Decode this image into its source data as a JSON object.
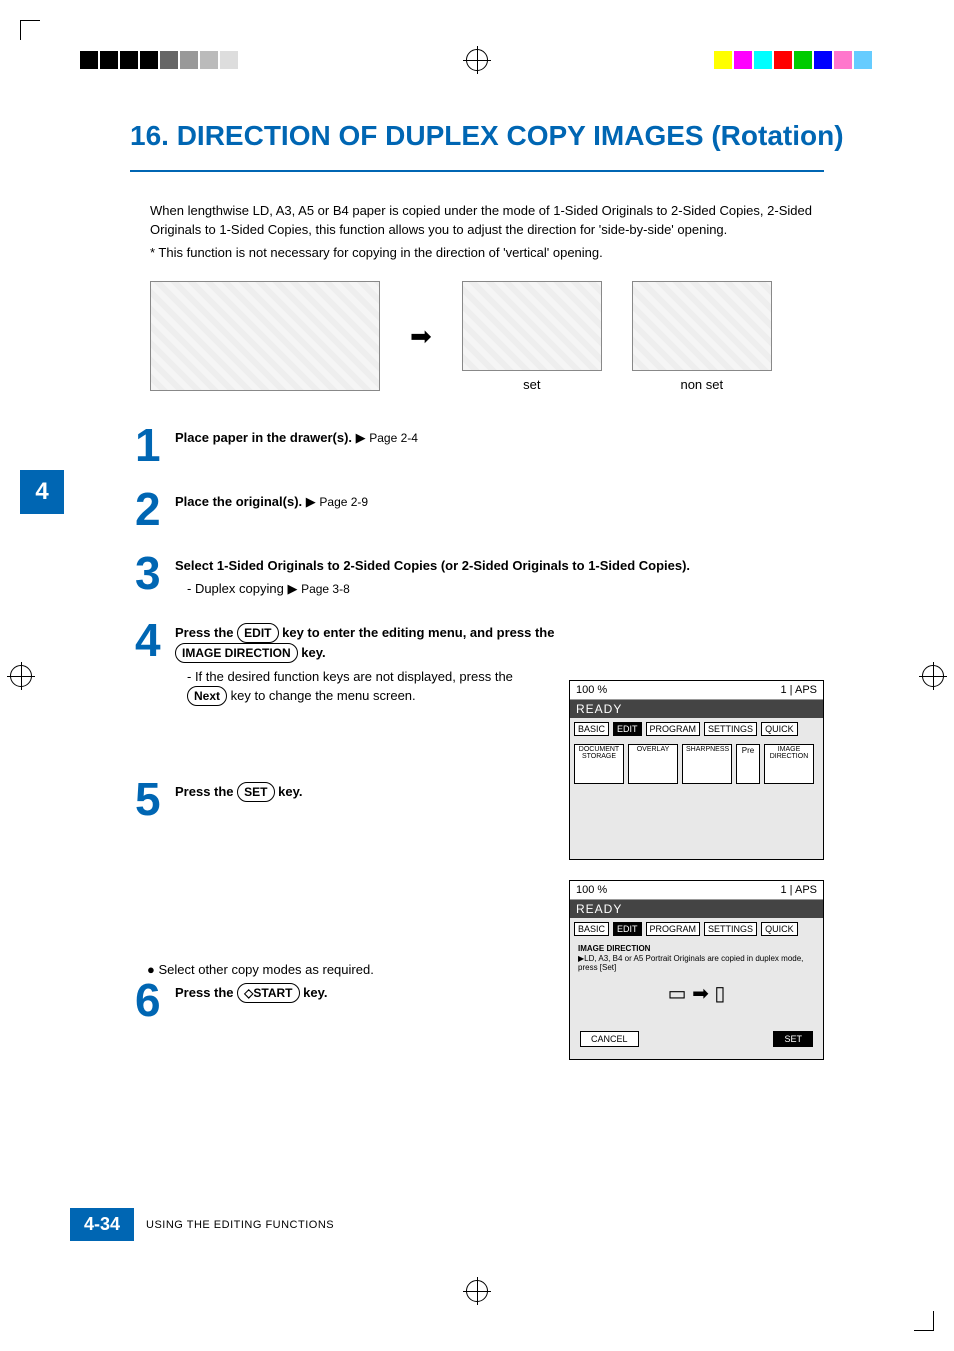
{
  "title": "16. DIRECTION OF DUPLEX COPY IMAGES (Rotation)",
  "intro": {
    "p1": "When lengthwise LD, A3, A5 or B4 paper is copied under the mode of 1-Sided Originals to 2-Sided Copies, 2-Sided Originals to 1-Sided Copies, this function allows you to adjust the direction for 'side-by-side' opening.",
    "note": "* This function is not necessary for copying in the direction of 'vertical' opening."
  },
  "diagram": {
    "set": "set",
    "nonset": "non set"
  },
  "side_tab": "4",
  "steps": {
    "s1": {
      "num": "1",
      "bold": "Place paper in the drawer(s).",
      "ref": "Page 2-4"
    },
    "s2": {
      "num": "2",
      "bold": "Place the original(s).",
      "ref": "Page 2-9"
    },
    "s3": {
      "num": "3",
      "bold": "Select 1-Sided Originals to 2-Sided Copies (or 2-Sided Originals to 1-Sided Copies).",
      "sub_label": "- Duplex copying",
      "sub_ref": "Page 3-8"
    },
    "s4": {
      "num": "4",
      "pre1": "Press the ",
      "key1": "EDIT",
      "mid1": " key to enter the editing menu, and press the ",
      "key2": "IMAGE DIRECTION",
      "post1": " key.",
      "sub_pre": "- If the desired function keys are not displayed, press the ",
      "sub_key": "Next",
      "sub_post": " key to change the menu screen."
    },
    "s5": {
      "num": "5",
      "pre": "Press the ",
      "key": "SET",
      "post": " key."
    },
    "bullet": "Select other copy modes as required.",
    "s6": {
      "num": "6",
      "pre": "Press the ",
      "key": "START",
      "post": " key."
    }
  },
  "screen1": {
    "zoom": "100 %",
    "count": "1",
    "mode": "APS",
    "ready": "READY",
    "tabs": [
      "BASIC",
      "EDIT",
      "PROGRAM",
      "SETTINGS",
      "QUICK"
    ],
    "icons": [
      "DOCUMENT STORAGE",
      "OVERLAY",
      "SHARPNESS",
      "Pre",
      "IMAGE DIRECTION"
    ]
  },
  "screen2": {
    "zoom": "100 %",
    "count": "1",
    "mode": "APS",
    "ready": "READY",
    "tabs": [
      "BASIC",
      "EDIT",
      "PROGRAM",
      "SETTINGS",
      "QUICK"
    ],
    "label": "IMAGE DIRECTION",
    "msg": "▶LD, A3, B4 or A5 Portrait Originals are copied in duplex mode, press [Set]",
    "cancel": "CANCEL",
    "set": "SET"
  },
  "footer": {
    "page": "4-34",
    "section": "USING THE EDITING FUNCTIONS"
  }
}
